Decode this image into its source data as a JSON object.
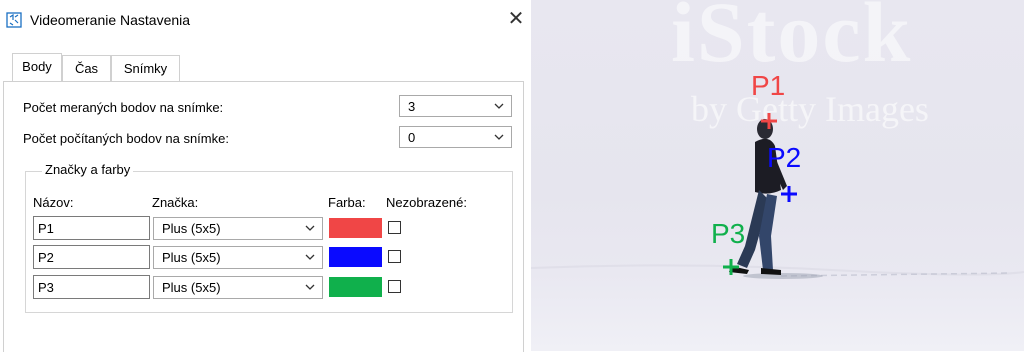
{
  "window": {
    "title": "Videomeranie Nastavenia",
    "close_symbol": "✕"
  },
  "tabs": [
    {
      "label": "Body",
      "active": true
    },
    {
      "label": "Čas",
      "active": false
    },
    {
      "label": "Snímky",
      "active": false
    }
  ],
  "settings": {
    "measured_label": "Počet meraných bodov na snímke:",
    "measured_value": "3",
    "computed_label": "Počet počítaných bodov na snímke:",
    "computed_value": "0"
  },
  "markers": {
    "group_title": "Značky a farby",
    "headers": {
      "name": "Názov:",
      "mark": "Značka:",
      "color": "Farba:",
      "hidden": "Nezobrazené:"
    },
    "rows": [
      {
        "name": "P1",
        "mark": "Plus (5x5)",
        "color": "#f04646",
        "hidden": false
      },
      {
        "name": "P2",
        "mark": "Plus (5x5)",
        "color": "#0a0aff",
        "hidden": false
      },
      {
        "name": "P3",
        "mark": "Plus (5x5)",
        "color": "#10b04c",
        "hidden": false
      }
    ]
  },
  "preview": {
    "watermark_main": "iStock",
    "watermark_sub": "by Getty Images",
    "points": [
      {
        "label": "P1",
        "color": "#f04646"
      },
      {
        "label": "P2",
        "color": "#0a0aff"
      },
      {
        "label": "P3",
        "color": "#10b04c"
      }
    ]
  }
}
